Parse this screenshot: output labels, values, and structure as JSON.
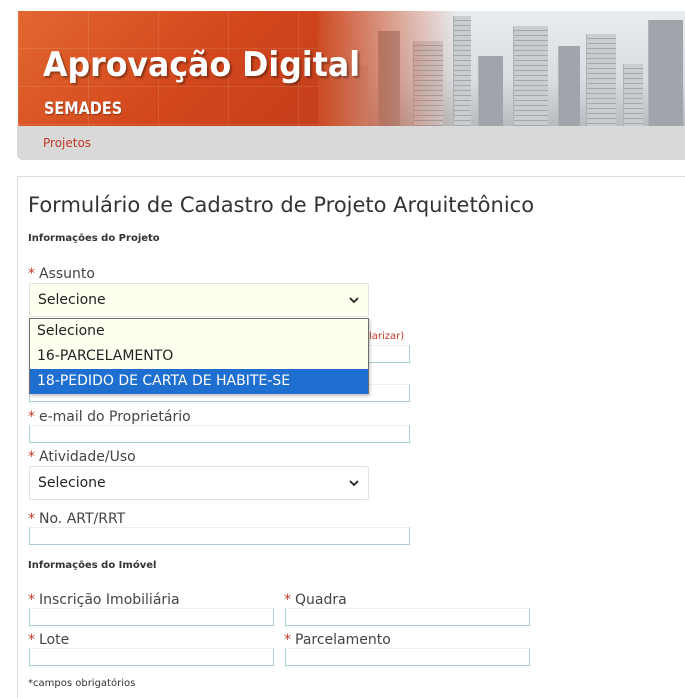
{
  "banner": {
    "title": "Aprovação Digital",
    "subtitle": "SEMADES"
  },
  "nav": {
    "items": [
      {
        "label": "Projetos"
      }
    ]
  },
  "form": {
    "title": "Formulário de Cadastro de Projeto Arquitetônico",
    "section_project": "Informações do Projeto",
    "section_property": "Informações do Imóvel",
    "required_mark": "*",
    "assunto": {
      "label": "Assunto",
      "selected": "Selecione",
      "options": [
        "Selecione",
        "16-PARCELAMENTO",
        "18-PEDIDO DE CARTA DE HABITE-SE"
      ],
      "highlighted_index": 2
    },
    "hidden_hint": "larizar)",
    "email_owner": {
      "label": "e-mail do Proprietário",
      "value": ""
    },
    "atividade": {
      "label": "Atividade/Uso",
      "selected": "Selecione"
    },
    "art_rrt": {
      "label": "No. ART/RRT",
      "value": ""
    },
    "inscricao": {
      "label": "Inscrição Imobiliária",
      "value": ""
    },
    "quadra": {
      "label": "Quadra",
      "value": ""
    },
    "lote": {
      "label": "Lote",
      "value": ""
    },
    "parcelamento": {
      "label": "Parcelamento",
      "value": ""
    },
    "footnote": "*campos obrigatórios"
  },
  "colors": {
    "accent_red": "#c0392b",
    "banner_orange": "#d85a2a",
    "highlight_blue": "#1f6fd1",
    "select_yellow": "#fffff0"
  }
}
